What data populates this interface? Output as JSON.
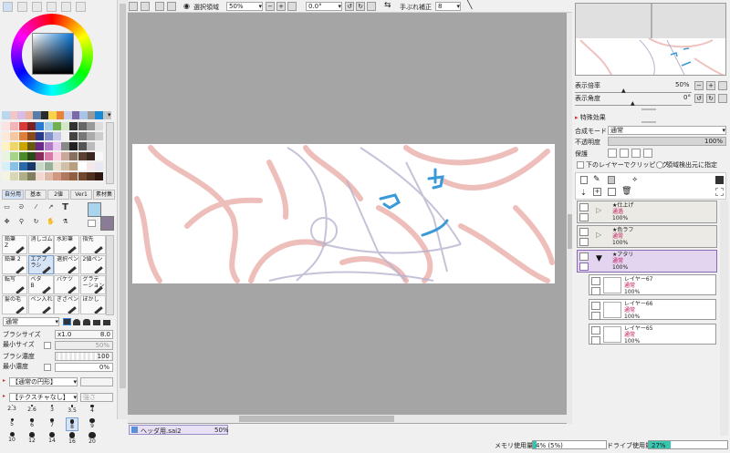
{
  "colors": {
    "canvas_bg": "#a5a5a5",
    "selected_layer": "#e3d4f0",
    "memory_bar": "#35c7b0",
    "accent": "#2f7fd6"
  },
  "top_toolbar": {
    "selection_label": "選択領域",
    "zoom_value": "50%",
    "rotation_value": "0.0°",
    "stabilizer_label": "手ぶれ補正",
    "stabilizer_value": "8"
  },
  "left_panel": {
    "tool_tabs": [
      "自分用",
      "基本",
      "2値",
      "Ver1",
      "素材集"
    ],
    "tools": [
      {
        "name": "鉛筆",
        "sub": "Z"
      },
      {
        "name": "消しゴム",
        "sub": ""
      },
      {
        "name": "水彩筆",
        "sub": ""
      },
      {
        "name": "指先",
        "sub": ""
      },
      {
        "name": "鉛筆 2",
        "sub": ""
      },
      {
        "name": "エアブラシ",
        "sub": ""
      },
      {
        "name": "選択ペン",
        "sub": ""
      },
      {
        "name": "2値ペン",
        "sub": ""
      },
      {
        "name": "転写",
        "sub": ""
      },
      {
        "name": "ベタ",
        "sub": "B"
      },
      {
        "name": "バケツ",
        "sub": ""
      },
      {
        "name": "グラデーション",
        "sub": ""
      },
      {
        "name": "髪の毛",
        "sub": ""
      },
      {
        "name": "ペン入れ",
        "sub": ""
      },
      {
        "name": "ぎざペン",
        "sub": ""
      },
      {
        "name": "ぼかし",
        "sub": ""
      }
    ],
    "blend_mode": "通常",
    "brush_size_label": "ブラシサイズ",
    "brush_size_mult": "x1.0",
    "brush_size_value": "8.0",
    "min_size_label": "最小サイズ",
    "min_size_value": "50%",
    "brush_density_label": "ブラシ濃度",
    "brush_density_value": "100",
    "min_density_label": "最小濃度",
    "min_density_value": "0%",
    "shape_label": "【通常の円形】",
    "texture_label": "【テクスチャなし】",
    "texture_value": "強さ",
    "brush_sizes_row1": [
      "2.3",
      "2.6",
      "3",
      "3.5",
      "4"
    ],
    "brush_sizes_row2": [
      "5",
      "6",
      "7",
      "8",
      "9"
    ],
    "brush_sizes_row3": [
      "10",
      "12",
      "14",
      "16",
      "20"
    ]
  },
  "document_tab": {
    "name": "ヘッダ用.sai2",
    "zoom": "50%"
  },
  "status_bar": {
    "memory_label": "メモリ使用量",
    "memory_value": "4% (5%)",
    "drive_label": "ドライブ使用量",
    "drive_value": "27%"
  },
  "navigator": {
    "zoom_label": "表示倍率",
    "zoom_value": "50%",
    "angle_label": "表示角度",
    "angle_value": "0°"
  },
  "effects": {
    "header": "特殊効果"
  },
  "layer_props": {
    "blend_label": "合成モード",
    "blend_value": "通常",
    "opacity_label": "不透明度",
    "opacity_value": "100%",
    "protect_label": "保護",
    "clip_label": "下のレイヤーでクリッピング",
    "region_label": "領域検出元に指定"
  },
  "layers": [
    {
      "name": "★仕上げ",
      "blend": "通過",
      "opacity": "100%",
      "type": "folder"
    },
    {
      "name": "★色ラフ",
      "blend": "通常",
      "opacity": "100%",
      "type": "folder"
    },
    {
      "name": "★アタリ",
      "blend": "通常",
      "opacity": "100%",
      "type": "folder",
      "selected": true
    },
    {
      "name": "レイヤー67",
      "blend": "通常",
      "opacity": "100%",
      "type": "layer"
    },
    {
      "name": "レイヤー66",
      "blend": "通常",
      "opacity": "100%",
      "type": "layer"
    },
    {
      "name": "レイヤー65",
      "blend": "通常",
      "opacity": "100%",
      "type": "layer"
    }
  ]
}
